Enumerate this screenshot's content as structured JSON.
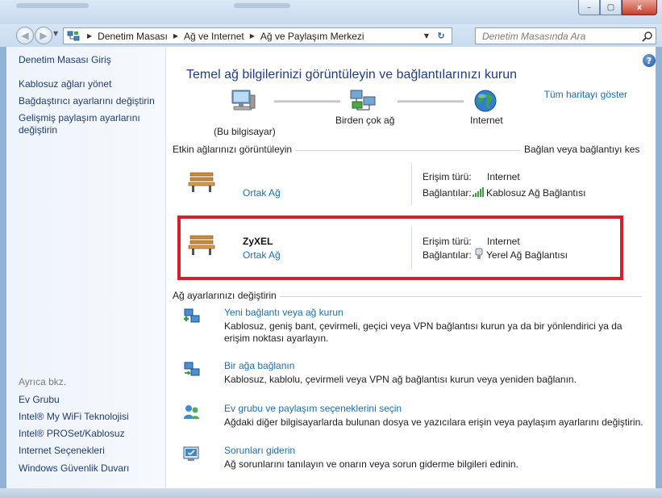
{
  "window": {
    "minimize": "–",
    "maximize": "▢",
    "close": "x"
  },
  "address": {
    "crumbs": [
      "Denetim Masası",
      "Ağ ve Internet",
      "Ağ ve Paylaşım Merkezi"
    ],
    "search_placeholder": "Denetim Masasında Ara"
  },
  "sidebar": {
    "home": "Denetim Masası Giriş",
    "links": [
      "Kablosuz ağları yönet",
      "Bağdaştırıcı ayarlarını değiştirin",
      "Gelişmiş paylaşım ayarlarını değiştirin"
    ],
    "see_also_heading": "Ayrıca bkz.",
    "see_also": [
      "Ev Grubu",
      "Intel® My WiFi Teknolojisi",
      "Intel® PROSet/Kablosuz",
      "Internet Seçenekleri",
      "Windows Güvenlik Duvarı"
    ]
  },
  "main": {
    "title": "Temel ağ bilgilerinizi görüntüleyin ve bağlantılarınızı kurun",
    "full_map_link": "Tüm haritayı göster",
    "map": {
      "this_computer": "(Bu bilgisayar)",
      "multiple_networks": "Birden çok ağ",
      "internet": "Internet"
    },
    "active_heading": "Etkin ağlarınızı görüntüleyin",
    "connect_disconnect_link": "Bağlan veya bağlantıyı kes",
    "access_type_label": "Erişim türü:",
    "connections_label": "Bağlantılar:",
    "networks": [
      {
        "name": "",
        "type": "Ortak Ağ",
        "access": "Internet",
        "connection": "Kablosuz Ağ Bağlantısı",
        "connection_icon": "wifi-signal-icon"
      },
      {
        "name": "ZyXEL",
        "type": "Ortak Ağ",
        "access": "Internet",
        "connection": "Yerel Ağ Bağlantısı",
        "connection_icon": "ethernet-plug-icon"
      }
    ],
    "change_heading": "Ağ ayarlarınızı değiştirin",
    "tasks": [
      {
        "title": "Yeni bağlantı veya ağ kurun",
        "desc": "Kablosuz, geniş bant, çevirmeli, geçici veya VPN bağlantısı kurun ya da bir yönlendirici ya da erişim noktası ayarlayın."
      },
      {
        "title": "Bir ağa bağlanın",
        "desc": "Kablosuz, kablolu, çevirmeli veya VPN ağ bağlantısı kurun veya yeniden bağlanın."
      },
      {
        "title": "Ev grubu ve paylaşım seçeneklerini seçin",
        "desc": "Ağdaki diğer bilgisayarlarda bulunan dosya ve yazıcılara erişin veya paylaşım ayarlarını değiştirin."
      },
      {
        "title": "Sorunları giderin",
        "desc": "Ağ sorunlarını tanılayın ve onarın veya sorun giderme bilgileri edinin."
      }
    ]
  },
  "colors": {
    "link": "#1a6fb5",
    "title": "#1e3d8a",
    "highlight": "#d81e2a"
  }
}
